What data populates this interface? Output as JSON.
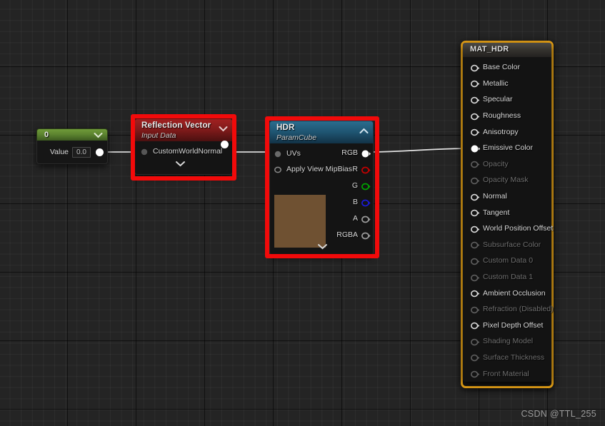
{
  "canvas": {
    "watermark": "CSDN @TTL_255",
    "grid_color": "#242424",
    "accent_red": "#f20a0a",
    "accent_orange": "#e8a317"
  },
  "nodes": {
    "constant": {
      "title": "0",
      "value_label": "Value",
      "value": "0.0",
      "header_color": "#5d8530",
      "collapse_icon": "chevron-down-icon"
    },
    "reflection_vector": {
      "title": "Reflection Vector",
      "subtitle": "Input Data",
      "header_color": "#7d1a1a",
      "collapse_icon": "chevron-down-icon",
      "expand_icon": "chevron-down-icon",
      "inputs": [
        {
          "label": "CustomWorldNormal",
          "pin": "filled-gray"
        }
      ],
      "outputs": [
        {
          "label": "",
          "pin": "filled-white"
        }
      ]
    },
    "hdr": {
      "title": "HDR",
      "subtitle": "ParamCube",
      "header_color": "#1f5572",
      "collapse_icon": "chevron-up-icon",
      "expand_icon": "chevron-down-icon",
      "texture_preview_color": "#6f5132",
      "inputs": [
        {
          "label": "UVs",
          "pin": "filled-gray"
        },
        {
          "label": "Apply View MipBias",
          "pin": "hollow-gray"
        }
      ],
      "outputs": [
        {
          "label": "RGB",
          "pin": "filled-white",
          "color": "#ffffff"
        },
        {
          "label": "R",
          "pin": "hollow",
          "color": "#c40000"
        },
        {
          "label": "G",
          "pin": "hollow",
          "color": "#00a300"
        },
        {
          "label": "B",
          "pin": "hollow",
          "color": "#1a1ad6"
        },
        {
          "label": "A",
          "pin": "hollow",
          "color": "#9a9a9a"
        },
        {
          "label": "RGBA",
          "pin": "hollow",
          "color": "#9a9a9a"
        }
      ]
    },
    "material": {
      "title": "MAT_HDR",
      "border_color": "#e8a317",
      "inputs": [
        {
          "label": "Base Color",
          "connected": false,
          "enabled": true
        },
        {
          "label": "Metallic",
          "connected": false,
          "enabled": true
        },
        {
          "label": "Specular",
          "connected": false,
          "enabled": true
        },
        {
          "label": "Roughness",
          "connected": false,
          "enabled": true
        },
        {
          "label": "Anisotropy",
          "connected": false,
          "enabled": true
        },
        {
          "label": "Emissive Color",
          "connected": true,
          "enabled": true
        },
        {
          "label": "Opacity",
          "connected": false,
          "enabled": false
        },
        {
          "label": "Opacity Mask",
          "connected": false,
          "enabled": false
        },
        {
          "label": "Normal",
          "connected": false,
          "enabled": true
        },
        {
          "label": "Tangent",
          "connected": false,
          "enabled": true
        },
        {
          "label": "World Position Offset",
          "connected": false,
          "enabled": true
        },
        {
          "label": "Subsurface Color",
          "connected": false,
          "enabled": false
        },
        {
          "label": "Custom Data 0",
          "connected": false,
          "enabled": false
        },
        {
          "label": "Custom Data 1",
          "connected": false,
          "enabled": false
        },
        {
          "label": "Ambient Occlusion",
          "connected": false,
          "enabled": true
        },
        {
          "label": "Refraction (Disabled)",
          "connected": false,
          "enabled": false
        },
        {
          "label": "Pixel Depth Offset",
          "connected": false,
          "enabled": true
        },
        {
          "label": "Shading Model",
          "connected": false,
          "enabled": false
        },
        {
          "label": "Surface Thickness",
          "connected": false,
          "enabled": false
        },
        {
          "label": "Front Material",
          "connected": false,
          "enabled": false
        }
      ]
    }
  },
  "highlights": [
    {
      "name": "reflection-vector-highlight"
    },
    {
      "name": "hdr-node-highlight"
    }
  ]
}
